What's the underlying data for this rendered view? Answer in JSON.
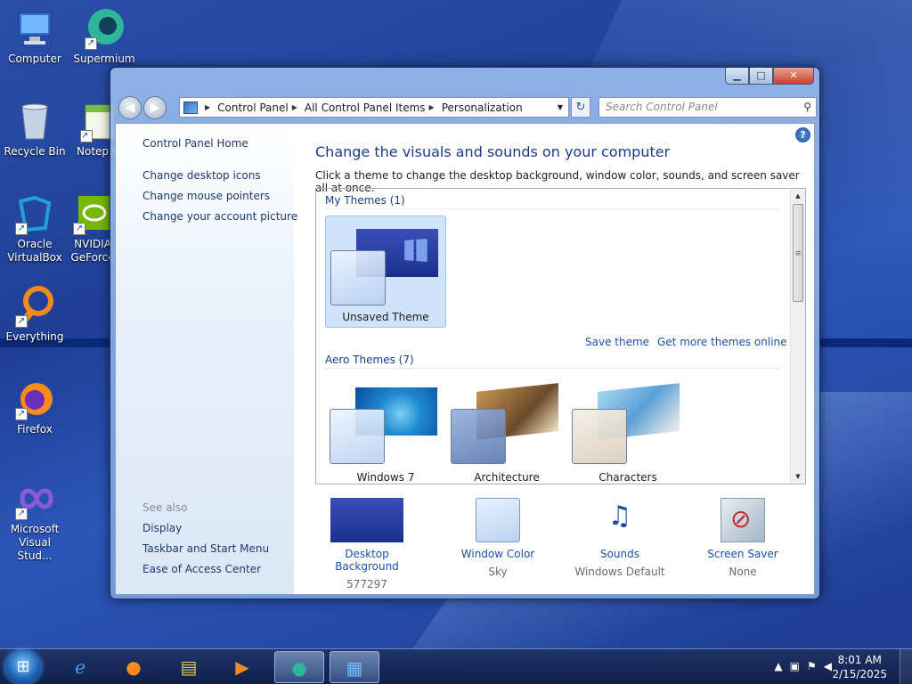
{
  "desktop": {
    "icons": [
      {
        "label": "Computer"
      },
      {
        "label": "Supermium"
      },
      {
        "label": "Recycle Bin"
      },
      {
        "label": "Notepad"
      },
      {
        "label": "Oracle VirtualBox"
      },
      {
        "label": "NVIDIA GeForce"
      },
      {
        "label": "Everything"
      },
      {
        "label": "Firefox"
      },
      {
        "label": "Microsoft Visual Stud..."
      }
    ]
  },
  "window": {
    "address": {
      "crumbs": [
        "Control Panel",
        "All Control Panel Items",
        "Personalization"
      ]
    },
    "search_placeholder": "Search Control Panel",
    "left_pane": {
      "home": "Control Panel Home",
      "links": [
        "Change desktop icons",
        "Change mouse pointers",
        "Change your account picture"
      ],
      "see_also_label": "See also",
      "see_also": [
        "Display",
        "Taskbar and Start Menu",
        "Ease of Access Center"
      ]
    },
    "main": {
      "title": "Change the visuals and sounds on your computer",
      "subtitle": "Click a theme to change the desktop background, window color, sounds, and screen saver all at once.",
      "my_themes_label": "My Themes (1)",
      "my_themes": [
        {
          "name": "Unsaved Theme"
        }
      ],
      "save_theme": "Save theme",
      "get_more": "Get more themes online",
      "aero_themes_label": "Aero Themes (7)",
      "aero_themes": [
        {
          "name": "Windows 7"
        },
        {
          "name": "Architecture"
        },
        {
          "name": "Characters"
        }
      ]
    },
    "bottom": [
      {
        "name": "Desktop Background",
        "value": "577297"
      },
      {
        "name": "Window Color",
        "value": "Sky"
      },
      {
        "name": "Sounds",
        "value": "Windows Default"
      },
      {
        "name": "Screen Saver",
        "value": "None"
      }
    ]
  },
  "taskbar": {
    "time": "8:01 AM",
    "date": "2/15/2025"
  }
}
